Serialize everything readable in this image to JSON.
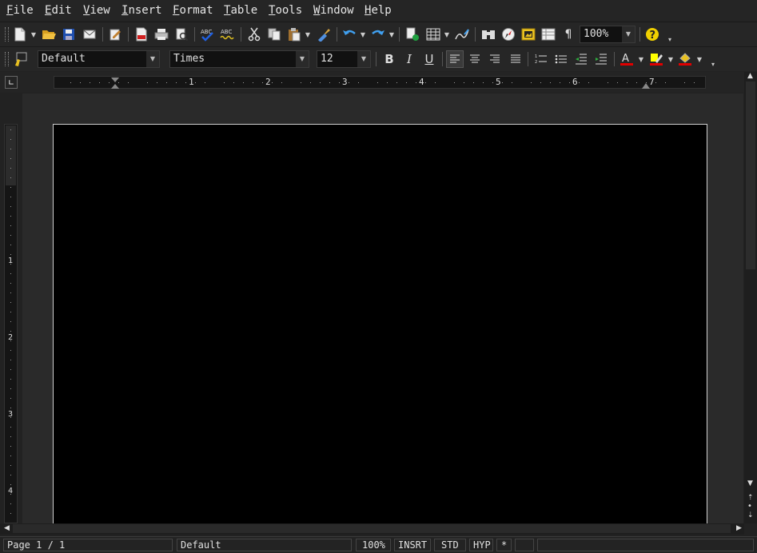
{
  "menu": {
    "items": [
      {
        "label": "File",
        "ul": "F",
        "rest": "ile"
      },
      {
        "label": "Edit",
        "ul": "E",
        "rest": "dit"
      },
      {
        "label": "View",
        "ul": "V",
        "rest": "iew"
      },
      {
        "label": "Insert",
        "ul": "I",
        "rest": "nsert"
      },
      {
        "label": "Format",
        "ul": "F",
        "rest": "ormat"
      },
      {
        "label": "Table",
        "ul": "T",
        "rest": "able"
      },
      {
        "label": "Tools",
        "ul": "T",
        "rest": "ools"
      },
      {
        "label": "Window",
        "ul": "W",
        "rest": "indow"
      },
      {
        "label": "Help",
        "ul": "H",
        "rest": "elp"
      }
    ]
  },
  "toolbar": {
    "zoom_value": "100%",
    "paragraph_style": "Default",
    "font_name": "Times",
    "font_size": "12",
    "bold_label": "B",
    "italic_label": "I",
    "underline_label": "U",
    "icons": {
      "new": "new-document-icon",
      "open": "open-folder-icon",
      "save": "save-icon",
      "email": "email-icon",
      "edit": "edit-file-icon",
      "pdf": "export-pdf-icon",
      "print": "print-icon",
      "preview": "page-preview-icon",
      "spell": "spellcheck-icon",
      "autospell": "autospellcheck-icon",
      "cut": "cut-icon",
      "copy": "copy-icon",
      "paste": "paste-icon",
      "clone": "clone-formatting-icon",
      "undo": "undo-icon",
      "redo": "redo-icon",
      "hyperlink": "hyperlink-icon",
      "table": "table-icon",
      "draw": "show-draw-functions-icon",
      "find": "find-replace-icon",
      "navigator": "navigator-icon",
      "gallery": "gallery-icon",
      "datasources": "data-sources-icon",
      "pilcrow": "formatting-marks-icon",
      "help": "help-icon"
    }
  },
  "ruler": {
    "h_numbers": [
      "1",
      "2",
      "3",
      "4",
      "5",
      "6",
      "7"
    ],
    "v_numbers": [
      "1",
      "2",
      "3",
      "4"
    ]
  },
  "status": {
    "page": "Page 1 / 1",
    "style": "Default",
    "zoom": "100%",
    "insert_mode": "INSRT",
    "selection_mode": "STD",
    "hyperlink_mode": "HYP",
    "modified": "*"
  },
  "colors": {
    "font_color": "#e00000",
    "highlight_color": "#ffff00",
    "background_color": "#e00000",
    "help_icon": "#f0d000"
  }
}
